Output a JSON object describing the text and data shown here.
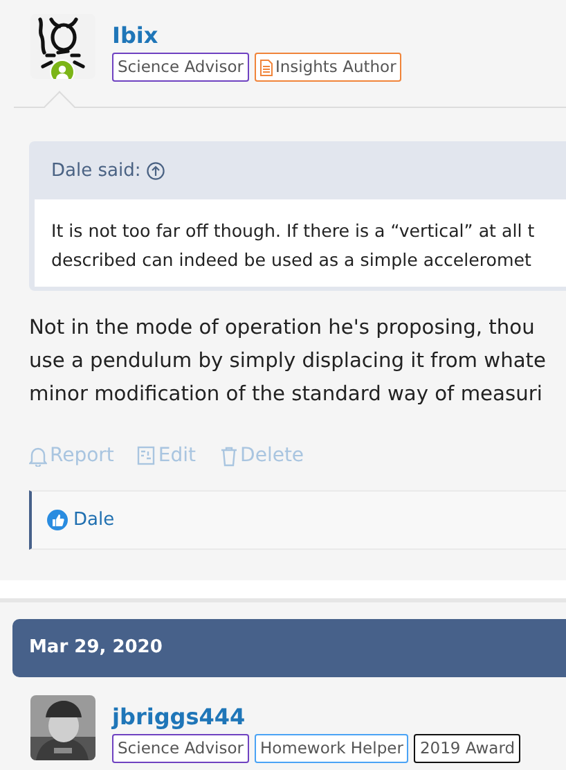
{
  "posts": [
    {
      "author": "Ibix",
      "online": true,
      "avatar": {
        "kind": "symbol"
      },
      "badges": [
        {
          "label": "Science Advisor",
          "color": "#6f42c1",
          "icon": false
        },
        {
          "label": "Insights Author",
          "color": "#f0843a",
          "icon": true
        }
      ],
      "quote": {
        "author": "Dale said:",
        "lines": [
          "It is not too far off though. If there is a “vertical” at all t",
          "described can indeed be used as a simple acceleromet"
        ]
      },
      "body": [
        "Not in the mode of operation he's proposing, thou",
        "use a pendulum by simply displacing it from whate",
        "minor modification of the standard way of measuri"
      ],
      "actions": [
        {
          "label": "Report",
          "kind": "report"
        },
        {
          "label": "Edit",
          "kind": "edit"
        },
        {
          "label": "Delete",
          "kind": "delete"
        }
      ],
      "reactions": [
        "Dale"
      ]
    },
    {
      "date": "Mar 29, 2020",
      "author": "jbriggs444",
      "online": false,
      "badges": [
        {
          "label": "Science Advisor",
          "color": "#6f42c1",
          "icon": false
        },
        {
          "label": "Homework Helper",
          "color": "#4aa3f5",
          "icon": false
        },
        {
          "label": "2019 Award",
          "color": "#111111",
          "icon": false
        }
      ]
    }
  ]
}
